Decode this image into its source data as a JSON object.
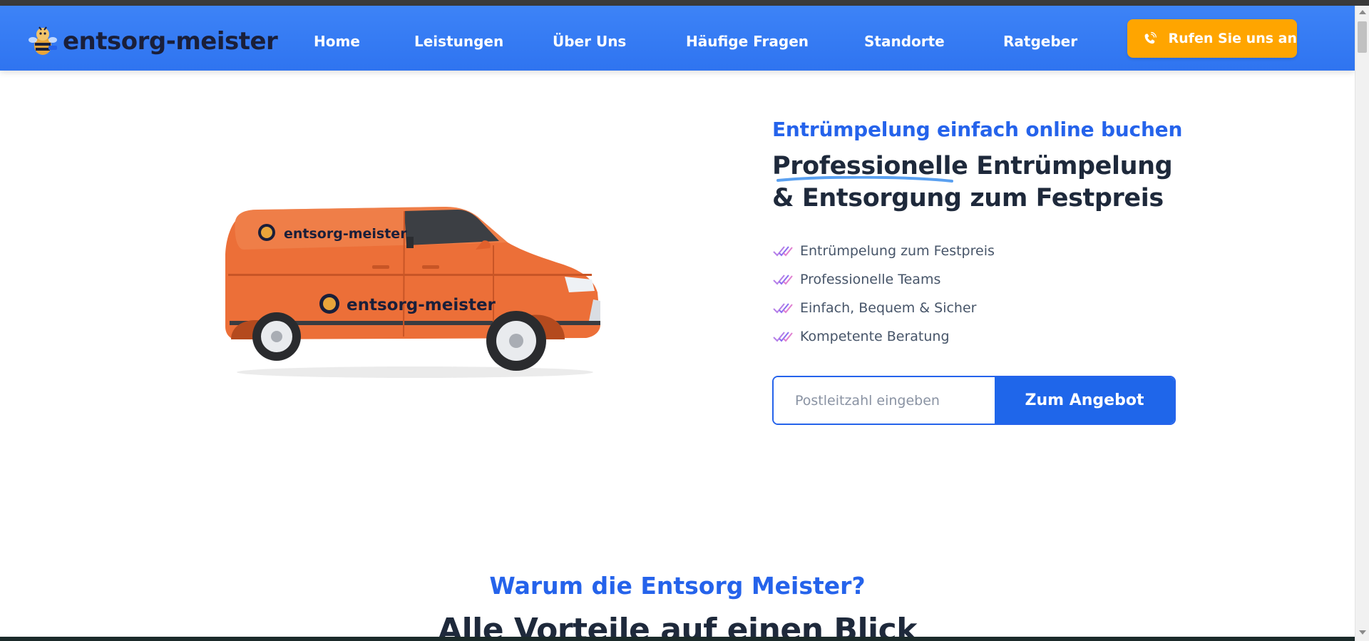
{
  "brand": {
    "name": "entsorg-meister",
    "colors": {
      "primary": "#2f74f0",
      "accent": "#ffa500",
      "dark": "#1e293b",
      "van": "#ec6f38"
    }
  },
  "nav": {
    "items": [
      {
        "label": "Home"
      },
      {
        "label": "Leistungen"
      },
      {
        "label": "Über Uns"
      },
      {
        "label": "Häufige Fragen"
      },
      {
        "label": "Standorte"
      },
      {
        "label": "Ratgeber"
      }
    ],
    "cta": {
      "label": "Rufen Sie uns an",
      "icon": "phone-icon"
    }
  },
  "hero": {
    "van_logo_text": "entsorg-meister",
    "eyebrow": "Entrümpelung einfach online buchen",
    "headline": {
      "underlined_word": "Professionelle",
      "line1_rest": " Entrümpelung",
      "line2": "& Entsorgung zum Festpreis"
    },
    "features": [
      {
        "text": "Entrümpelung zum Festpreis",
        "icon": "double-check-icon"
      },
      {
        "text": "Professionelle Teams",
        "icon": "double-check-icon"
      },
      {
        "text": "Einfach, Bequem & Sicher",
        "icon": "double-check-icon"
      },
      {
        "text": "Kompetente Beratung",
        "icon": "double-check-icon"
      }
    ],
    "zip_form": {
      "placeholder": "Postleitzahl eingeben",
      "value": "",
      "button_label": "Zum Angebot"
    }
  },
  "why_section": {
    "eyebrow": "Warum die Entsorg Meister?",
    "title": "Alle Vorteile auf einen Blick"
  }
}
